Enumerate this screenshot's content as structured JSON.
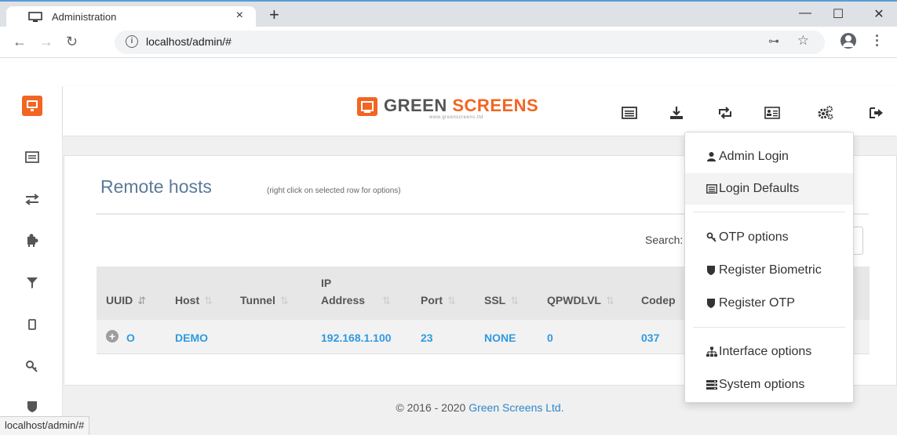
{
  "browser": {
    "tab_title": "Administration",
    "tab_close": "×",
    "new_tab": "+",
    "minimize": "—",
    "maximize": "☐",
    "close": "✕",
    "url": "localhost/admin/#",
    "status_url": "localhost/admin/#"
  },
  "brand": {
    "part1": "GREEN",
    "part2": "SCREENS",
    "tagline": "www.greenscreens.ltd"
  },
  "page": {
    "title": "Remote hosts",
    "subtitle": "(right click on selected row for options)",
    "search_label": "Search:"
  },
  "table": {
    "headers": [
      "UUID",
      "Host",
      "Tunnel",
      "IP",
      "Address",
      "Port",
      "SSL",
      "QPWDLVL",
      "Codep"
    ],
    "rows": [
      {
        "uuid": "O",
        "host": "DEMO",
        "tunnel": "",
        "ip_address": "192.168.1.100",
        "port": "23",
        "ssl": "NONE",
        "qpwdlvl": "0",
        "codepage": "037"
      }
    ]
  },
  "dropdown": {
    "items": [
      {
        "label": "Admin Login",
        "icon": "user-icon"
      },
      {
        "label": "Login Defaults",
        "icon": "list-icon"
      },
      {
        "label": "OTP options",
        "icon": "key-icon"
      },
      {
        "label": "Register Biometric",
        "icon": "shield-icon"
      },
      {
        "label": "Register OTP",
        "icon": "shield-icon"
      },
      {
        "label": "Interface options",
        "icon": "sitemap-icon"
      },
      {
        "label": "System options",
        "icon": "server-icon"
      }
    ]
  },
  "footer": {
    "copyright": "© 2016 - 2020",
    "company": "Green Screens Ltd."
  },
  "colors": {
    "accent": "#f26522",
    "link": "#2f9ae0",
    "title": "#5b7a99"
  }
}
